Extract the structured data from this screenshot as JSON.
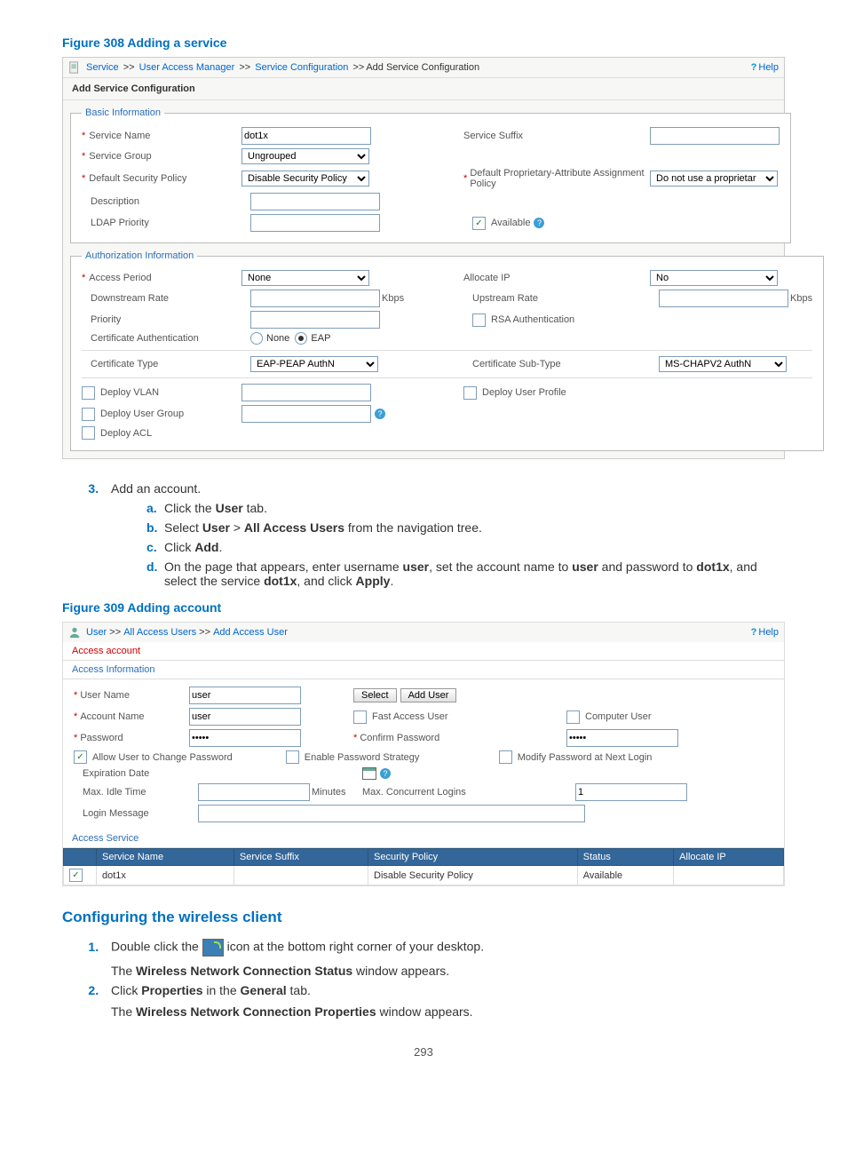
{
  "figure308": {
    "title": "Figure 308 Adding a service",
    "breadcrumb": {
      "parts": [
        "Service",
        "User Access Manager",
        "Service Configuration",
        "Add Service Configuration"
      ],
      "help": "Help"
    },
    "paneTitle": "Add Service Configuration",
    "basic": {
      "legend": "Basic Information",
      "serviceName": {
        "label": "Service Name",
        "value": "dot1x"
      },
      "serviceSuffix": {
        "label": "Service Suffix",
        "value": ""
      },
      "serviceGroup": {
        "label": "Service Group",
        "value": "Ungrouped"
      },
      "defaultSecurityPolicy": {
        "label": "Default Security Policy",
        "value": "Disable Security Policy"
      },
      "defaultProprietary": {
        "label": "Default Proprietary-Attribute Assignment Policy",
        "value": "Do not use a proprietar"
      },
      "description": {
        "label": "Description",
        "value": ""
      },
      "ldapPriority": {
        "label": "LDAP Priority",
        "value": ""
      },
      "available": {
        "label": "Available"
      }
    },
    "auth": {
      "legend": "Authorization Information",
      "accessPeriod": {
        "label": "Access Period",
        "value": "None"
      },
      "allocateIP": {
        "label": "Allocate IP",
        "value": "No"
      },
      "downstreamRate": {
        "label": "Downstream Rate",
        "value": "",
        "unit": "Kbps"
      },
      "upstreamRate": {
        "label": "Upstream Rate",
        "value": "",
        "unit": "Kbps"
      },
      "priority": {
        "label": "Priority",
        "value": ""
      },
      "rsa": {
        "label": "RSA Authentication"
      },
      "certAuth": {
        "label": "Certificate Authentication",
        "none": "None",
        "eap": "EAP"
      },
      "certType": {
        "label": "Certificate Type",
        "value": "EAP-PEAP AuthN"
      },
      "certSubType": {
        "label": "Certificate Sub-Type",
        "value": "MS-CHAPV2 AuthN"
      },
      "deployVlan": {
        "label": "Deploy VLAN",
        "value": ""
      },
      "deployUserProfile": {
        "label": "Deploy User Profile"
      },
      "deployUserGroup": {
        "label": "Deploy User Group",
        "value": ""
      },
      "deployAcl": {
        "label": "Deploy ACL"
      }
    }
  },
  "steps": {
    "three": "Add an account.",
    "a": {
      "pre": "Click the ",
      "bold": "User",
      "post": " tab."
    },
    "b": {
      "pre": "Select ",
      "b1": "User",
      "gt": " > ",
      "b2": "All Access Users",
      "post": " from the navigation tree."
    },
    "c": {
      "pre": "Click ",
      "bold": "Add",
      "post": "."
    },
    "d": {
      "pre": "On the page that appears, enter username ",
      "b1": "user",
      "mid1": ", set the account name to ",
      "b2": "user",
      "mid2": " and password to ",
      "b3": "dot1x",
      "mid3": ", and select the service ",
      "b4": "dot1x",
      "mid4": ", and click ",
      "b5": "Apply",
      "post": "."
    }
  },
  "figure309": {
    "title": "Figure 309 Adding account",
    "breadcrumb": {
      "parts": [
        "User",
        "All Access Users",
        "Add Access User"
      ],
      "help": "Help"
    },
    "paneTitle": "Access account",
    "accessInfo": {
      "legend": "Access Information",
      "userName": {
        "label": "User Name",
        "value": "user"
      },
      "select": "Select",
      "addUser": "Add User",
      "accountName": {
        "label": "Account Name",
        "value": "user"
      },
      "fastAccessUser": "Fast Access User",
      "computerUser": "Computer User",
      "password": {
        "label": "Password",
        "value": "•••••"
      },
      "confirmPassword": {
        "label": "Confirm Password",
        "value": "•••••"
      },
      "allowUserChangePw": "Allow User to Change Password",
      "enablePwStrategy": "Enable Password Strategy",
      "modifyPwNext": "Modify Password at Next Login",
      "expirationDate": "Expiration Date",
      "maxIdle": {
        "label": "Max. Idle Time",
        "value": "",
        "unit": "Minutes"
      },
      "maxConcurrent": {
        "label": "Max. Concurrent Logins",
        "value": "1"
      },
      "loginMessage": {
        "label": "Login Message",
        "value": ""
      }
    },
    "accessService": {
      "legend": "Access Service",
      "headers": [
        "",
        "Service Name",
        "Service Suffix",
        "Security Policy",
        "Status",
        "Allocate IP"
      ],
      "row": {
        "name": "dot1x",
        "suffix": "",
        "policy": "Disable Security Policy",
        "status": "Available",
        "allocate": ""
      }
    }
  },
  "wireless": {
    "title": "Configuring the wireless client",
    "s1a": "Double click the ",
    "s1b": " icon at the bottom right corner of your desktop.",
    "s1res": {
      "pre": "The ",
      "bold": "Wireless Network Connection Status",
      "post": " window appears."
    },
    "s2": {
      "pre": "Click ",
      "b1": "Properties",
      "mid": " in the ",
      "b2": "General",
      "post": " tab."
    },
    "s2res": {
      "pre": "The ",
      "bold": "Wireless Network Connection Properties",
      "post": " window appears."
    }
  },
  "pageNum": "293"
}
